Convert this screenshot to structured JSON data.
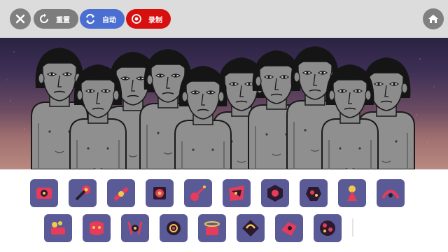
{
  "toolbar": {
    "close_icon": "close-icon",
    "reset": {
      "label": "重置",
      "color": "#7d7d7d",
      "icon": "reset-icon"
    },
    "auto": {
      "label": "自动",
      "color": "#4a6fd0",
      "icon": "auto-icon"
    },
    "record": {
      "label": "录制",
      "color": "#d80f0f",
      "icon": "record-icon"
    },
    "home_icon": "home-icon"
  },
  "stage": {
    "characters_count": 10,
    "sky_colors": [
      "#2b2342",
      "#b98a80"
    ]
  },
  "palette": {
    "tile_color": "#5a5a96",
    "accent_colors": [
      "#e63b5a",
      "#f2c94c",
      "#2b1a2e"
    ],
    "row1": [
      "sound-icon-1",
      "sound-icon-2",
      "sound-icon-3",
      "sound-icon-4",
      "sound-icon-5",
      "sound-icon-6",
      "sound-icon-7",
      "sound-icon-8",
      "sound-icon-9",
      "sound-icon-10"
    ],
    "row2": [
      "sound-icon-11",
      "sound-icon-12",
      "sound-icon-13",
      "sound-icon-14",
      "sound-icon-15",
      "sound-icon-16",
      "sound-icon-17",
      "sound-icon-18"
    ]
  }
}
